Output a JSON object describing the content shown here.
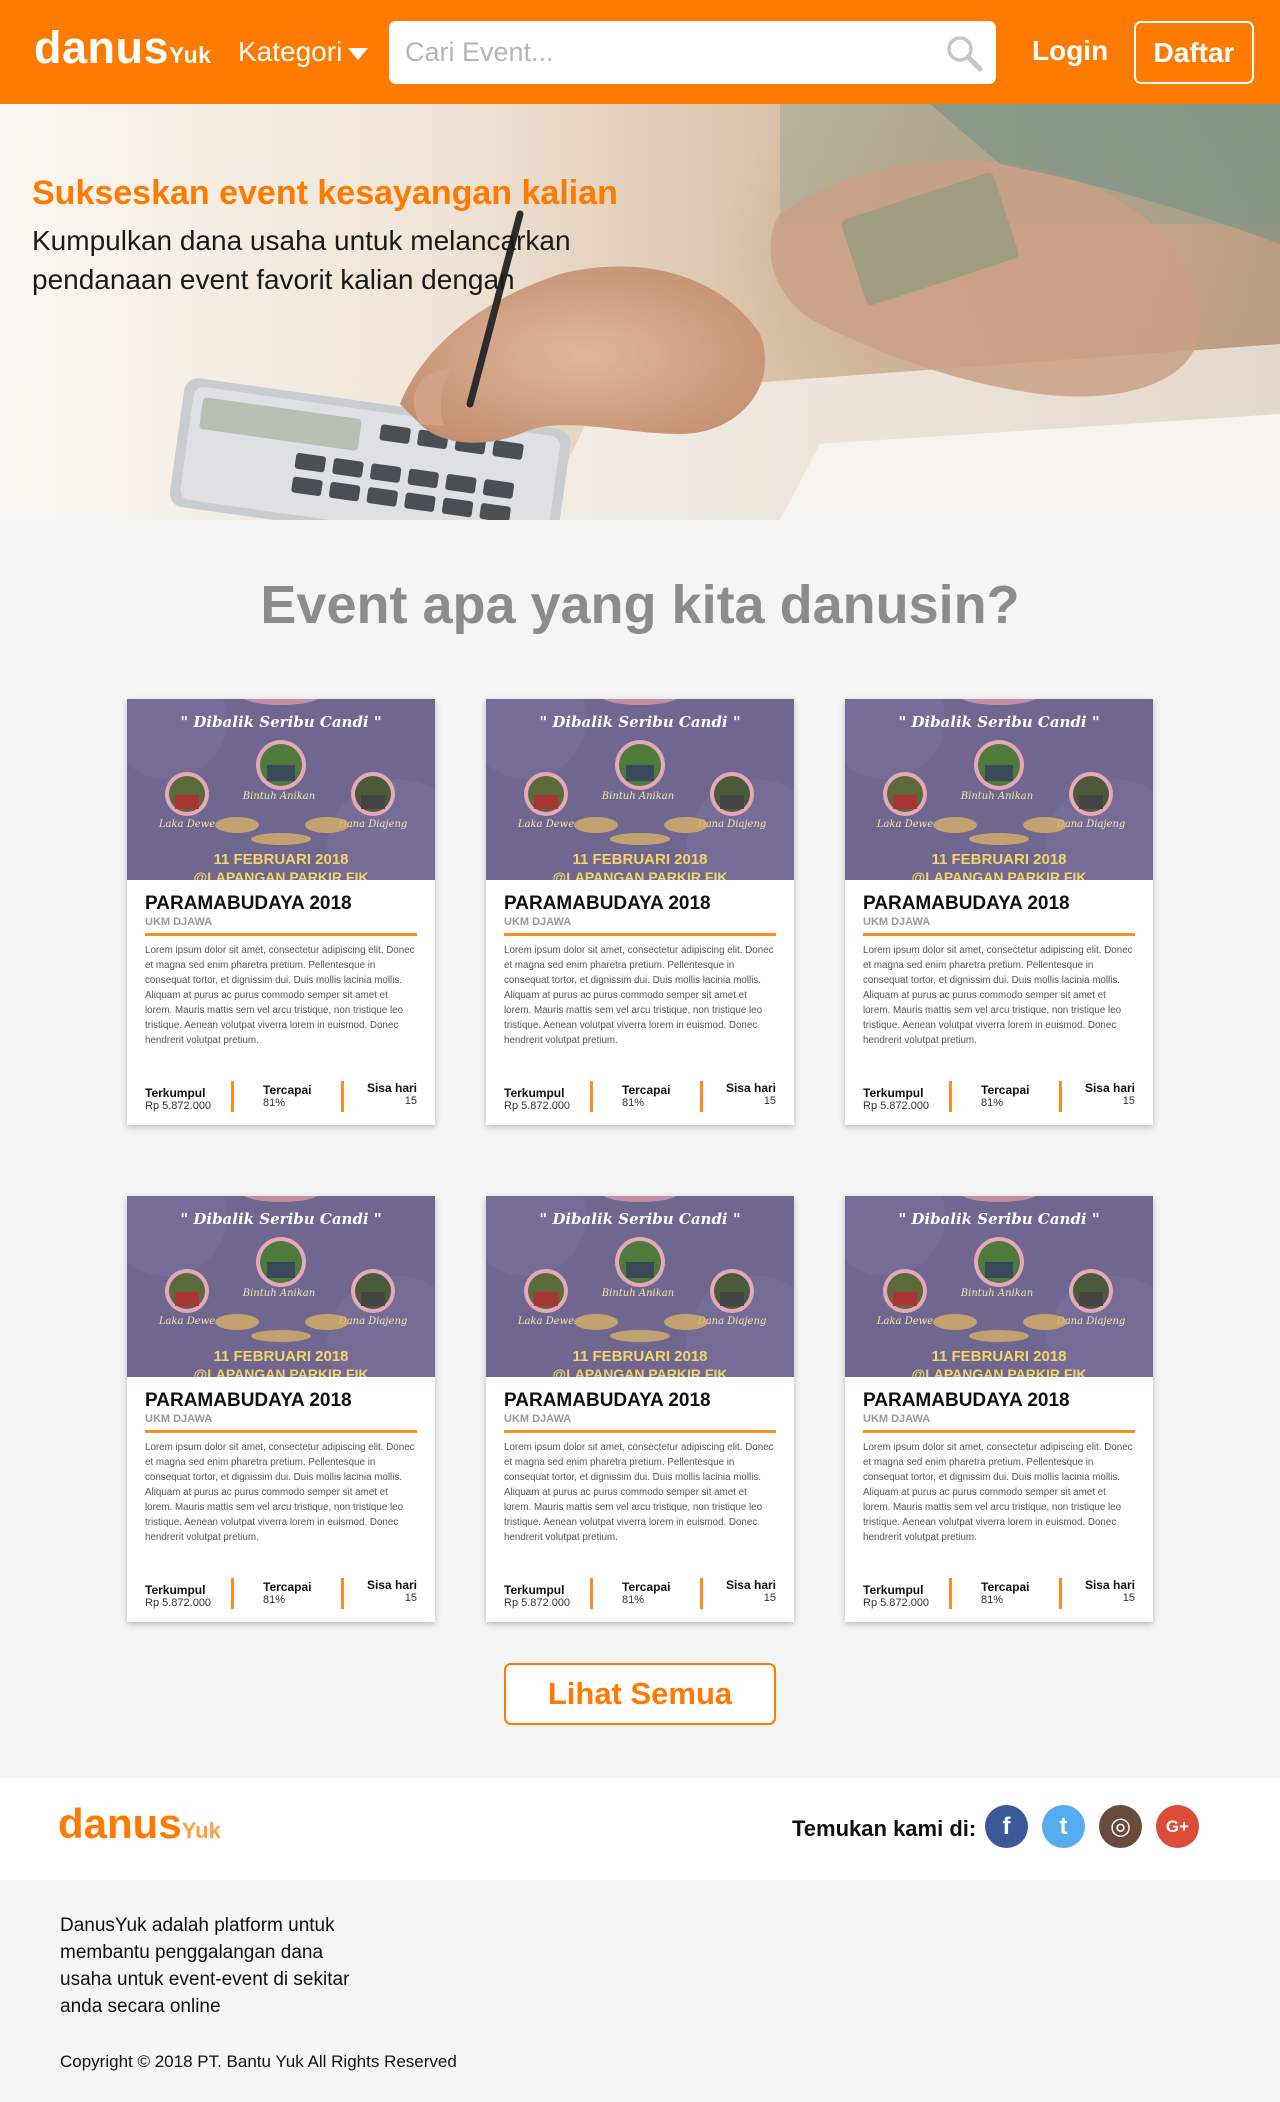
{
  "header": {
    "logo_main": "danus",
    "logo_suffix": "Yuk",
    "kategori_label": "Kategori",
    "search_placeholder": "Cari Event...",
    "login_label": "Login",
    "daftar_label": "Daftar"
  },
  "hero": {
    "title": "Sukseskan event kesayangan kalian",
    "subtitle": "Kumpulkan dana usaha untuk melancarkan pendanaan event favorit kalian dengan"
  },
  "section": {
    "title": "Event apa yang kita danusin?"
  },
  "cards": [
    {
      "poster_title": "\" Dibalik Seribu Candi \"",
      "poster_date": "11 FEBRUARI 2018",
      "poster_venue": "@LAPANGAN PARKIR FIK",
      "poster_names": [
        "Laka Dewe",
        "Bintuh Anikan",
        "Dana Diajeng"
      ],
      "title": "PARAMABUDAYA 2018",
      "org": "UKM DJAWA",
      "desc": "Lorem ipsum dolor sit amet, consectetur adipiscing elit. Donec et magna sed enim pharetra pretium. Pellentesque in consequat tortor, et dignissim dui. Duis mollis lacinia mollis. Aliquam at purus ac purus commodo semper sit amet et lorem. Mauris mattis sem vel arcu tristique, non tristique leo tristique. Aenean volutpat viverra lorem in euismod. Donec hendrerit volutpat pretium.",
      "terkumpul_label": "Terkumpul",
      "terkumpul_value": "Rp 5.872.000",
      "tercapai_label": "Tercapai",
      "tercapai_value": "81%",
      "sisa_label": "Sisa hari",
      "sisa_value": "15"
    },
    {
      "poster_title": "\" Dibalik Seribu Candi \"",
      "poster_date": "11 FEBRUARI 2018",
      "poster_venue": "@LAPANGAN PARKIR FIK",
      "poster_names": [
        "Laka Dewe",
        "Bintuh Anikan",
        "Dana Diajeng"
      ],
      "title": "PARAMABUDAYA 2018",
      "org": "UKM DJAWA",
      "desc": "Lorem ipsum dolor sit amet, consectetur adipiscing elit. Donec et magna sed enim pharetra pretium. Pellentesque in consequat tortor, et dignissim dui. Duis mollis lacinia mollis. Aliquam at purus ac purus commodo semper sit amet et lorem. Mauris mattis sem vel arcu tristique, non tristique leo tristique. Aenean volutpat viverra lorem in euismod. Donec hendrerit volutpat pretium.",
      "terkumpul_label": "Terkumpul",
      "terkumpul_value": "Rp 5.872.000",
      "tercapai_label": "Tercapai",
      "tercapai_value": "81%",
      "sisa_label": "Sisa hari",
      "sisa_value": "15"
    },
    {
      "poster_title": "\" Dibalik Seribu Candi \"",
      "poster_date": "11 FEBRUARI 2018",
      "poster_venue": "@LAPANGAN PARKIR FIK",
      "poster_names": [
        "Laka Dewe",
        "Bintuh Anikan",
        "Dana Diajeng"
      ],
      "title": "PARAMABUDAYA 2018",
      "org": "UKM DJAWA",
      "desc": "Lorem ipsum dolor sit amet, consectetur adipiscing elit. Donec et magna sed enim pharetra pretium. Pellentesque in consequat tortor, et dignissim dui. Duis mollis lacinia mollis. Aliquam at purus ac purus commodo semper sit amet et lorem. Mauris mattis sem vel arcu tristique, non tristique leo tristique. Aenean volutpat viverra lorem in euismod. Donec hendrerit volutpat pretium.",
      "terkumpul_label": "Terkumpul",
      "terkumpul_value": "Rp 5.872.000",
      "tercapai_label": "Tercapai",
      "tercapai_value": "81%",
      "sisa_label": "Sisa hari",
      "sisa_value": "15"
    },
    {
      "poster_title": "\" Dibalik Seribu Candi \"",
      "poster_date": "11 FEBRUARI 2018",
      "poster_venue": "@LAPANGAN PARKIR FIK",
      "poster_names": [
        "Laka Dewe",
        "Bintuh Anikan",
        "Dana Diajeng"
      ],
      "title": "PARAMABUDAYA 2018",
      "org": "UKM DJAWA",
      "desc": "Lorem ipsum dolor sit amet, consectetur adipiscing elit. Donec et magna sed enim pharetra pretium. Pellentesque in consequat tortor, et dignissim dui. Duis mollis lacinia mollis. Aliquam at purus ac purus commodo semper sit amet et lorem. Mauris mattis sem vel arcu tristique, non tristique leo tristique. Aenean volutpat viverra lorem in euismod. Donec hendrerit volutpat pretium.",
      "terkumpul_label": "Terkumpul",
      "terkumpul_value": "Rp 5.872.000",
      "tercapai_label": "Tercapai",
      "tercapai_value": "81%",
      "sisa_label": "Sisa hari",
      "sisa_value": "15"
    },
    {
      "poster_title": "\" Dibalik Seribu Candi \"",
      "poster_date": "11 FEBRUARI 2018",
      "poster_venue": "@LAPANGAN PARKIR FIK",
      "poster_names": [
        "Laka Dewe",
        "Bintuh Anikan",
        "Dana Diajeng"
      ],
      "title": "PARAMABUDAYA 2018",
      "org": "UKM DJAWA",
      "desc": "Lorem ipsum dolor sit amet, consectetur adipiscing elit. Donec et magna sed enim pharetra pretium. Pellentesque in consequat tortor, et dignissim dui. Duis mollis lacinia mollis. Aliquam at purus ac purus commodo semper sit amet et lorem. Mauris mattis sem vel arcu tristique, non tristique leo tristique. Aenean volutpat viverra lorem in euismod. Donec hendrerit volutpat pretium.",
      "terkumpul_label": "Terkumpul",
      "terkumpul_value": "Rp 5.872.000",
      "tercapai_label": "Tercapai",
      "tercapai_value": "81%",
      "sisa_label": "Sisa hari",
      "sisa_value": "15"
    },
    {
      "poster_title": "\" Dibalik Seribu Candi \"",
      "poster_date": "11 FEBRUARI 2018",
      "poster_venue": "@LAPANGAN PARKIR FIK",
      "poster_names": [
        "Laka Dewe",
        "Bintuh Anikan",
        "Dana Diajeng"
      ],
      "title": "PARAMABUDAYA 2018",
      "org": "UKM DJAWA",
      "desc": "Lorem ipsum dolor sit amet, consectetur adipiscing elit. Donec et magna sed enim pharetra pretium. Pellentesque in consequat tortor, et dignissim dui. Duis mollis lacinia mollis. Aliquam at purus ac purus commodo semper sit amet et lorem. Mauris mattis sem vel arcu tristique, non tristique leo tristique. Aenean volutpat viverra lorem in euismod. Donec hendrerit volutpat pretium.",
      "terkumpul_label": "Terkumpul",
      "terkumpul_value": "Rp 5.872.000",
      "tercapai_label": "Tercapai",
      "tercapai_value": "81%",
      "sisa_label": "Sisa hari",
      "sisa_value": "15"
    }
  ],
  "lihat_semua_label": "Lihat Semua",
  "footer": {
    "logo_main": "danus",
    "logo_suffix": "Yuk",
    "temukan_label": "Temukan kami di:",
    "social": [
      {
        "icon": "facebook-icon",
        "glyph": "f",
        "color": "#3b5998"
      },
      {
        "icon": "twitter-icon",
        "glyph": "t",
        "color": "#55acee"
      },
      {
        "icon": "instagram-icon",
        "glyph": "◎",
        "color": "#6a4a3a"
      },
      {
        "icon": "google-plus-icon",
        "glyph": "G+",
        "color": "#dd4b39"
      }
    ],
    "about": "DanusYuk adalah platform untuk membantu penggalangan dana usaha untuk event-event di sekitar anda secara online",
    "copyright": "Copyright © 2018 PT. Bantu Yuk All Rights Reserved"
  },
  "colors": {
    "brand_orange": "#ff7a00",
    "poster_purple": "#6f678f"
  }
}
